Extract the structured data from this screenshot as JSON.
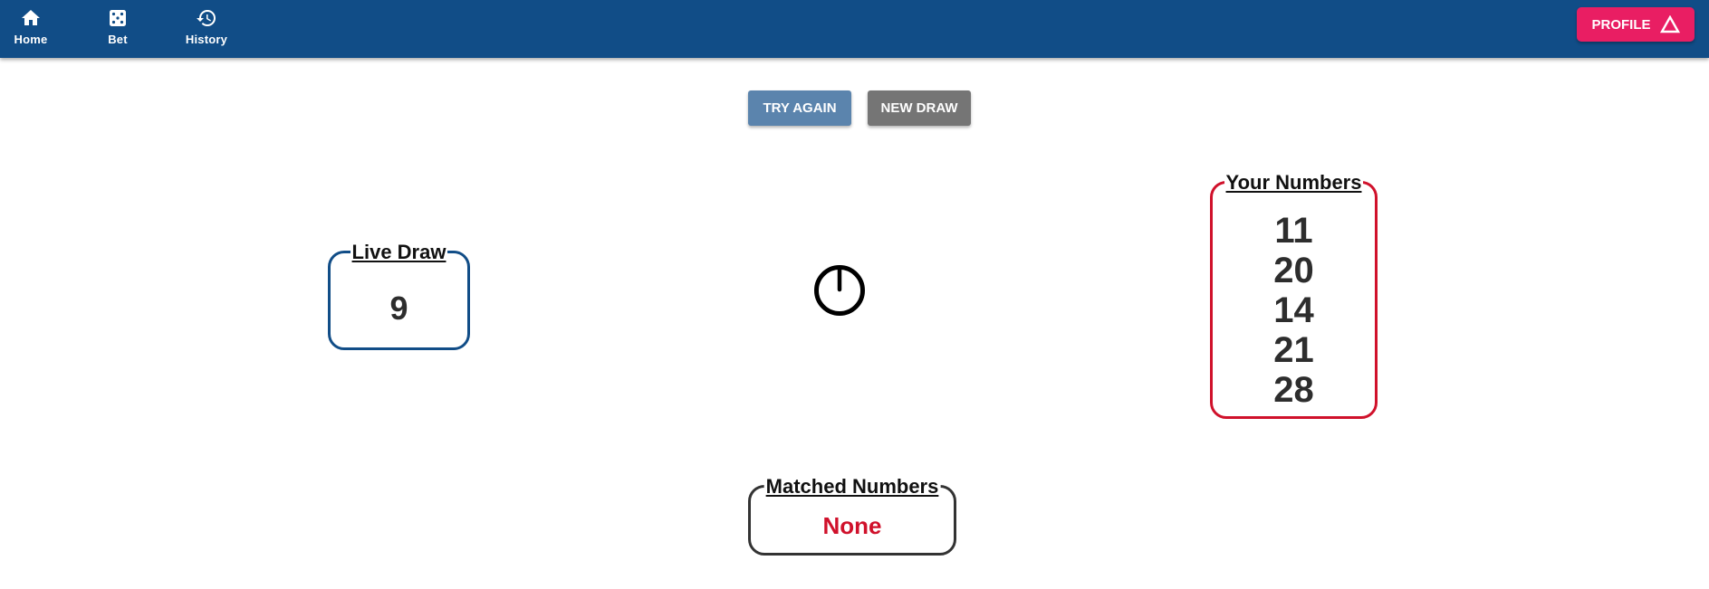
{
  "nav": {
    "items": [
      {
        "label": "Home",
        "icon": "home-icon"
      },
      {
        "label": "Bet",
        "icon": "dice-icon"
      },
      {
        "label": "History",
        "icon": "history-icon"
      }
    ],
    "profile_label": "PROFILE",
    "profile_icon": "warning-triangle-icon",
    "bar_color": "#114d87",
    "profile_color": "#e91e63"
  },
  "actions": {
    "try_again_label": "TRY AGAIN",
    "new_draw_label": "NEW DRAW",
    "try_again_color": "#5b84ad",
    "new_draw_color": "#757575"
  },
  "live_draw": {
    "title": "Live Draw",
    "value": "9",
    "border_color": "#114d87"
  },
  "center_icon": "power-icon",
  "your_numbers": {
    "title": "Your Numbers",
    "values": [
      "11",
      "20",
      "14",
      "21",
      "28"
    ],
    "border_color": "#d0112b"
  },
  "matched": {
    "title": "Matched Numbers",
    "value": "None",
    "value_color": "#d0112b"
  }
}
